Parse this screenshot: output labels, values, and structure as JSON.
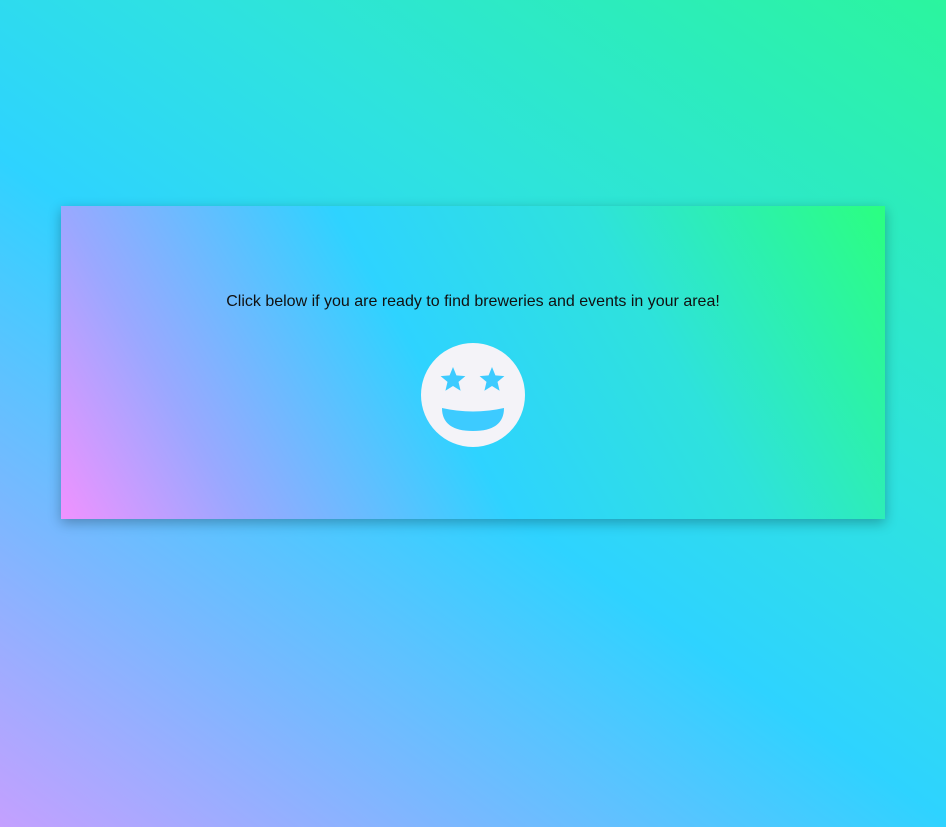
{
  "card": {
    "prompt": "Click below if you are ready to find breweries and events in your area!"
  },
  "cta": {
    "icon": "grin-stars-icon",
    "face_color": "#f4f3f8",
    "feature_color": "#2ed3ff"
  }
}
